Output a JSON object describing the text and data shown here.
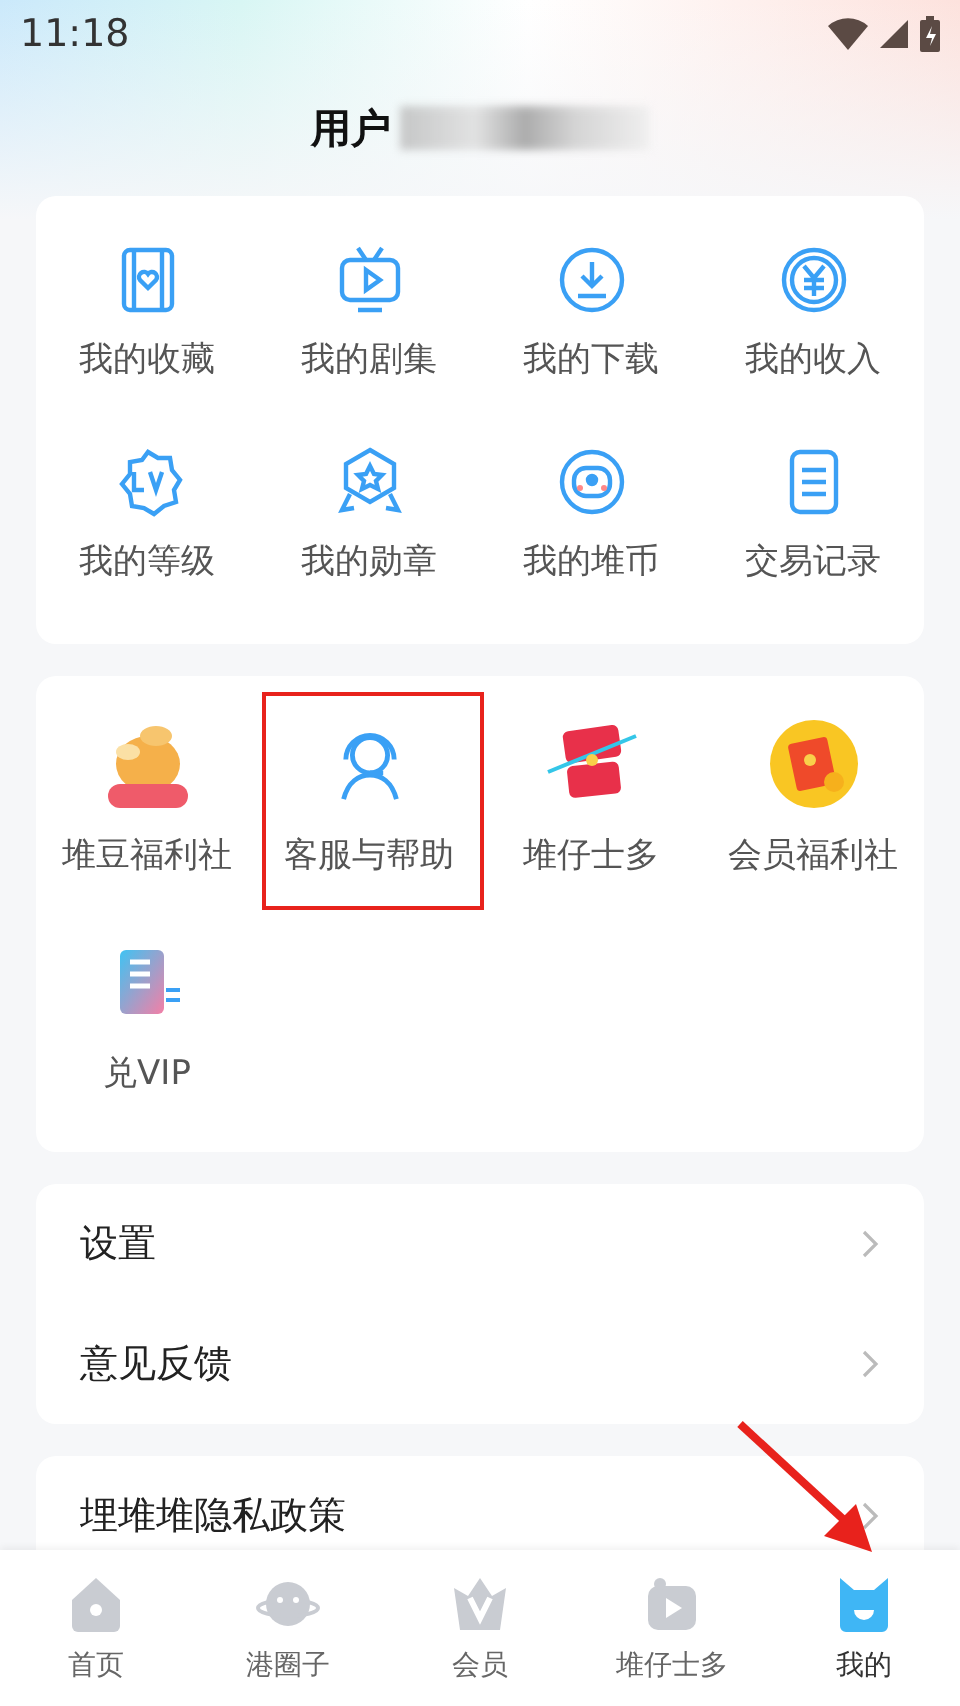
{
  "status_bar": {
    "time": "11:18"
  },
  "profile": {
    "name": "用户"
  },
  "my_grid": [
    {
      "label": "我的收藏"
    },
    {
      "label": "我的剧集"
    },
    {
      "label": "我的下载"
    },
    {
      "label": "我的收入"
    },
    {
      "label": "我的等级"
    },
    {
      "label": "我的勋章"
    },
    {
      "label": "我的堆币"
    },
    {
      "label": "交易记录"
    }
  ],
  "services": [
    {
      "label": "堆豆福利社",
      "highlighted": false
    },
    {
      "label": "客服与帮助",
      "highlighted": true
    },
    {
      "label": "堆仔士多",
      "highlighted": false
    },
    {
      "label": "会员福利社",
      "highlighted": false
    },
    {
      "label": "兑VIP",
      "highlighted": false
    }
  ],
  "settings": [
    {
      "label": "设置"
    },
    {
      "label": "意见反馈"
    }
  ],
  "privacy": {
    "label": "埋堆堆隐私政策"
  },
  "tabs": [
    {
      "label": "首页",
      "selected": false
    },
    {
      "label": "港圈子",
      "selected": false
    },
    {
      "label": "会员",
      "selected": false
    },
    {
      "label": "堆仔士多",
      "selected": false
    },
    {
      "label": "我的",
      "selected": true
    }
  ]
}
